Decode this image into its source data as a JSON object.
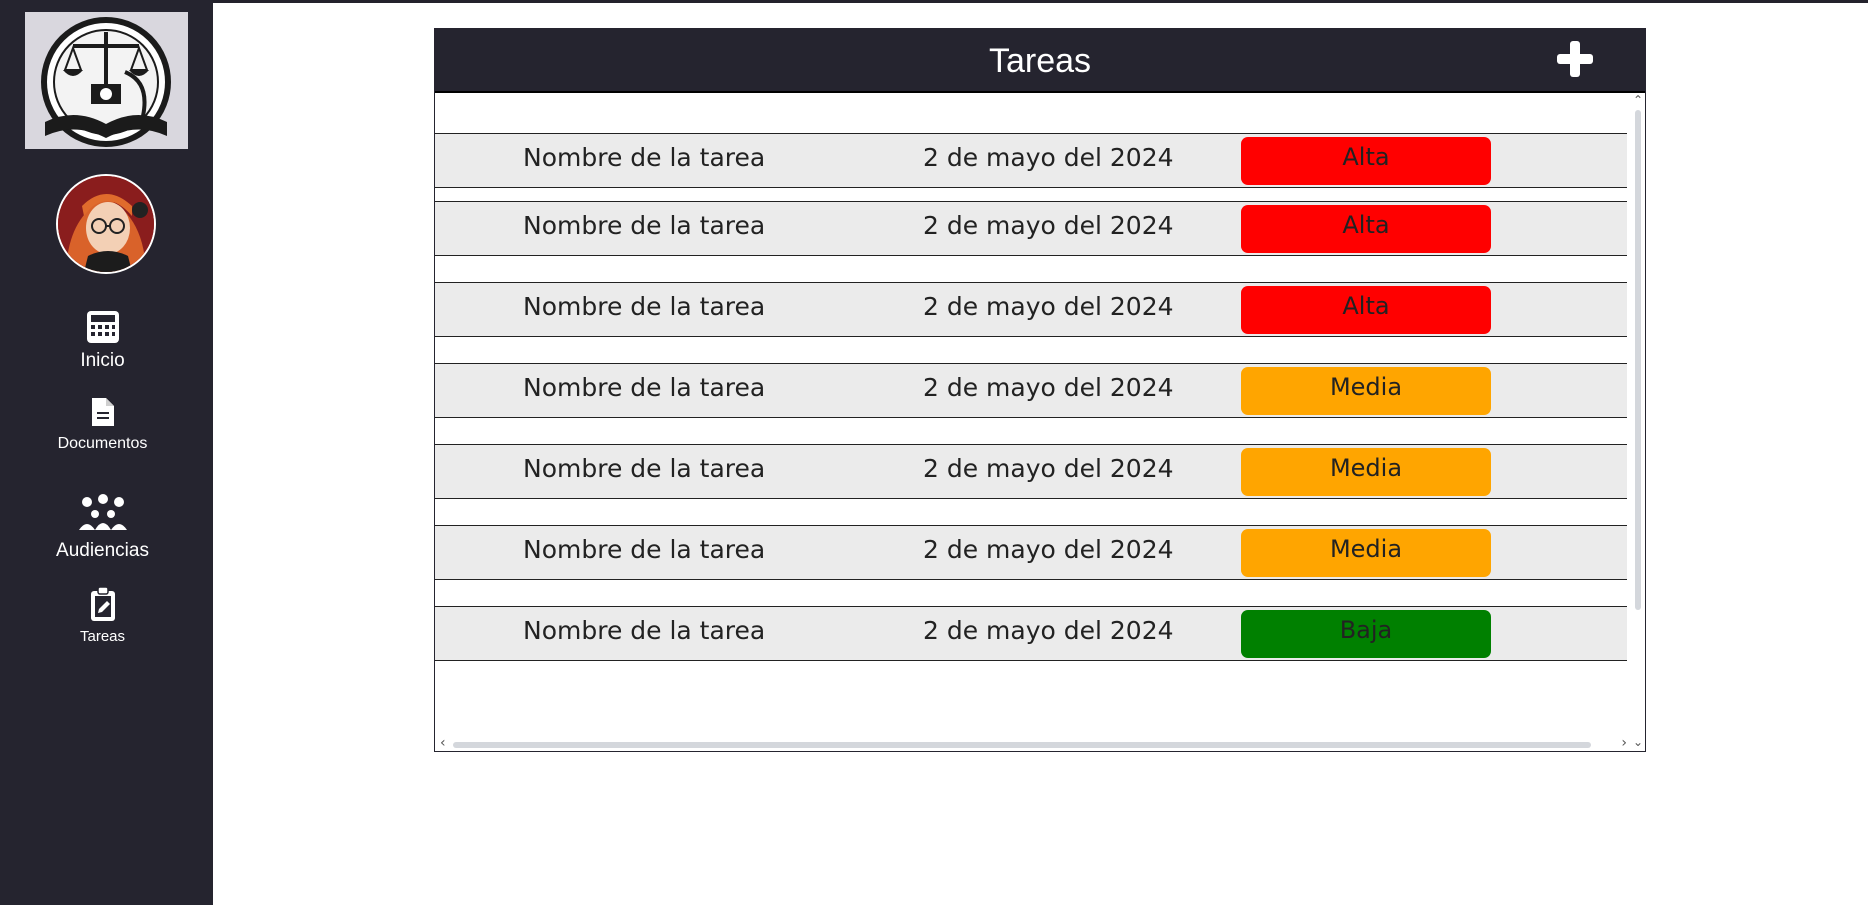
{
  "sidebar": {
    "items": [
      {
        "label": "Inicio",
        "icon": "calculator-icon"
      },
      {
        "label": "Documentos",
        "icon": "document-icon"
      },
      {
        "label": "Audiencias",
        "icon": "people-icon"
      },
      {
        "label": "Tareas",
        "icon": "clipboard-icon"
      }
    ]
  },
  "panel": {
    "title": "Tareas",
    "add_icon": "plus-icon"
  },
  "tasks": [
    {
      "name": "Nombre de la tarea",
      "date": "2 de mayo del 2024",
      "priority": "Alta",
      "color": "#ff0000"
    },
    {
      "name": "Nombre de la tarea",
      "date": "2 de mayo del 2024",
      "priority": "Alta",
      "color": "#ff0000"
    },
    {
      "name": "Nombre de la tarea",
      "date": "2 de mayo del 2024",
      "priority": "Alta",
      "color": "#ff0000"
    },
    {
      "name": "Nombre de la tarea",
      "date": "2 de mayo del 2024",
      "priority": "Media",
      "color": "#ffa500"
    },
    {
      "name": "Nombre de la tarea",
      "date": "2 de mayo del 2024",
      "priority": "Media",
      "color": "#ffa500"
    },
    {
      "name": "Nombre de la tarea",
      "date": "2 de mayo del 2024",
      "priority": "Media",
      "color": "#ffa500"
    },
    {
      "name": "Nombre de la tarea",
      "date": "2 de mayo del 2024",
      "priority": "Baja",
      "color": "#008000"
    }
  ],
  "colors": {
    "sidebar_bg": "#25242f",
    "row_bg": "#ebebeb",
    "high": "#ff0000",
    "medium": "#ffa500",
    "low": "#008000"
  }
}
